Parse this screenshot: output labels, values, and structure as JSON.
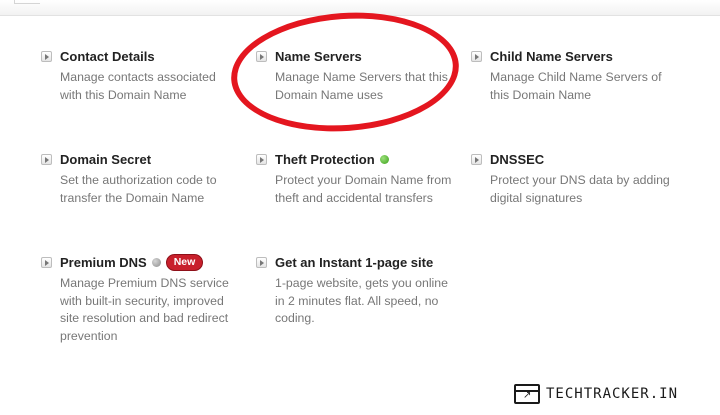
{
  "services": [
    {
      "id": "contact-details",
      "title": "Contact Details",
      "description": "Manage contacts associated with this Domain Name"
    },
    {
      "id": "name-servers",
      "title": "Name Servers",
      "description": "Manage Name Servers that this Domain Name uses"
    },
    {
      "id": "child-name-servers",
      "title": "Child Name Servers",
      "description": "Manage Child Name Servers of this Domain Name"
    },
    {
      "id": "domain-secret",
      "title": "Domain Secret",
      "description": "Set the authorization code to transfer the Domain Name"
    },
    {
      "id": "theft-protection",
      "title": "Theft Protection",
      "description": "Protect your Domain Name from theft and accidental transfers",
      "status_color": "#3aa01a"
    },
    {
      "id": "dnssec",
      "title": "DNSSEC",
      "description": "Protect your DNS data by adding digital signatures"
    },
    {
      "id": "premium-dns",
      "title": "Premium DNS",
      "description": "Manage Premium DNS service with built-in security, improved site resolution and bad redirect prevention",
      "status_color": "#8c8c8c",
      "badge": "New"
    },
    {
      "id": "instant-site",
      "title": "Get an Instant 1-page site",
      "description": "1-page website, gets you online in 2 minutes flat. All speed, no coding."
    }
  ],
  "annotation": {
    "circle_color": "#e4161f"
  },
  "watermark": {
    "text": "TECHTRACKER.IN"
  },
  "colors": {
    "title": "#222222",
    "description": "#777777",
    "badge": "#c8202c"
  }
}
